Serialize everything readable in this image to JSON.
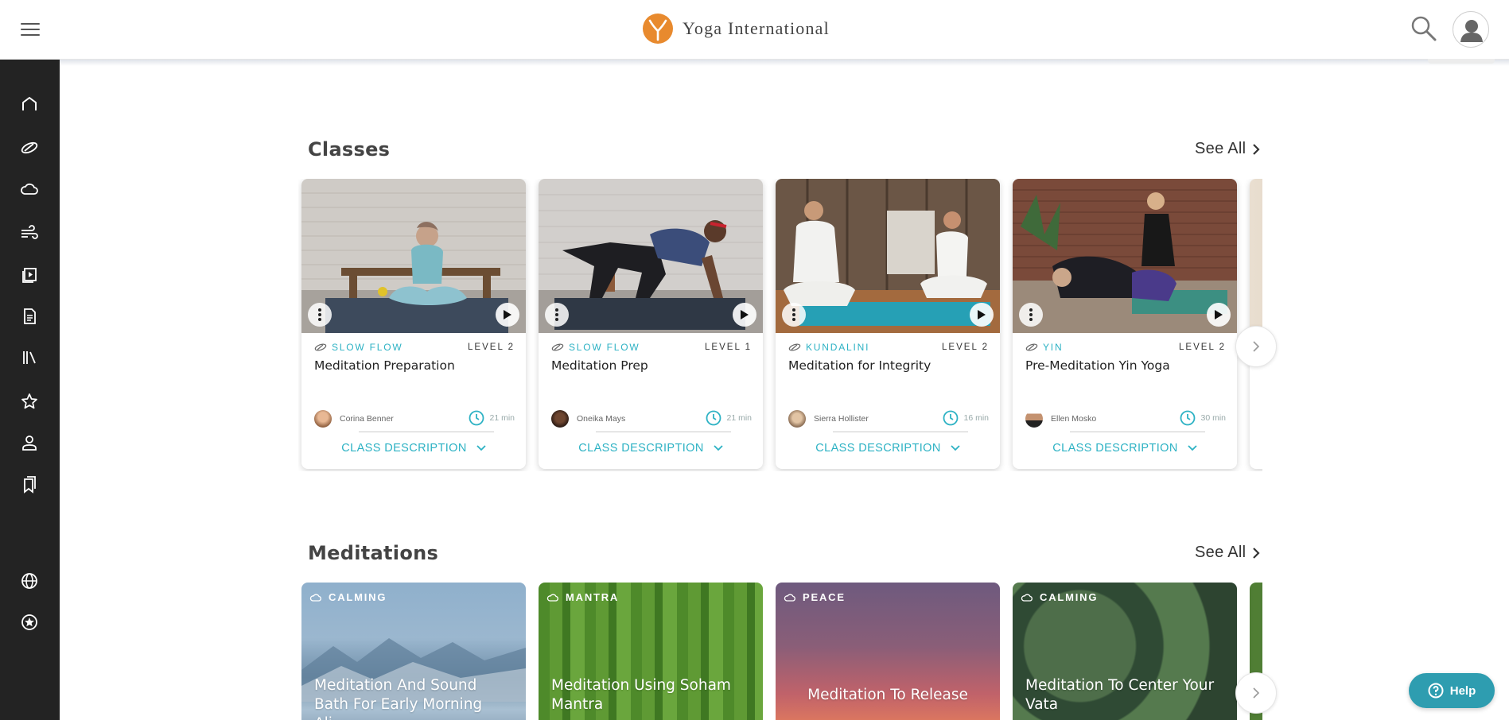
{
  "header": {
    "brand": "Yoga International",
    "menu_icon": "hamburger-menu-icon",
    "search_icon": "search-icon",
    "profile_icon": "user-avatar-icon"
  },
  "sidebar": {
    "items": [
      {
        "icon": "home-icon"
      },
      {
        "icon": "yoga-class-icon"
      },
      {
        "icon": "cloud-meditation-icon"
      },
      {
        "icon": "wind-breath-icon"
      },
      {
        "icon": "video-icon"
      },
      {
        "icon": "article-icon"
      },
      {
        "icon": "library-icon"
      },
      {
        "icon": "star-favorites-icon"
      },
      {
        "icon": "teacher-icon"
      },
      {
        "icon": "bookmark-icon"
      },
      {
        "icon": "globe-icon"
      },
      {
        "icon": "badge-icon"
      }
    ]
  },
  "classes": {
    "title": "Classes",
    "see_all": "See All",
    "cards": [
      {
        "style": "SLOW FLOW",
        "level": "LEVEL 2",
        "title": "Meditation Preparation",
        "instructor": "Corina Benner",
        "duration": "21 min",
        "description": "CLASS DESCRIPTION"
      },
      {
        "style": "SLOW FLOW",
        "level": "LEVEL 1",
        "title": "Meditation Prep",
        "instructor": "Oneika Mays",
        "duration": "21 min",
        "description": "CLASS DESCRIPTION"
      },
      {
        "style": "KUNDALINI",
        "level": "LEVEL 2",
        "title": "Meditation for Integrity",
        "instructor": "Sierra Hollister",
        "duration": "16 min",
        "description": "CLASS DESCRIPTION"
      },
      {
        "style": "YIN",
        "level": "LEVEL 2",
        "title": "Pre-Meditation Yin Yoga",
        "instructor": "Ellen Mosko",
        "duration": "30 min",
        "description": "CLASS DESCRIPTION"
      }
    ]
  },
  "meditations": {
    "title": "Meditations",
    "see_all": "See All",
    "cards": [
      {
        "tag": "CALMING",
        "title": "Meditation And Sound Bath For Early Morning Ali..."
      },
      {
        "tag": "MANTRA",
        "title": "Meditation Using Soham Mantra"
      },
      {
        "tag": "PEACE",
        "title": "Meditation To Release"
      },
      {
        "tag": "CALMING",
        "title": "Meditation To Center Your Vata"
      }
    ]
  },
  "help": {
    "label": "Help"
  },
  "colors": {
    "accent": "#2db2c4",
    "sidebar": "#232323",
    "help": "#2e9db0",
    "logo": "#e88a2e"
  }
}
